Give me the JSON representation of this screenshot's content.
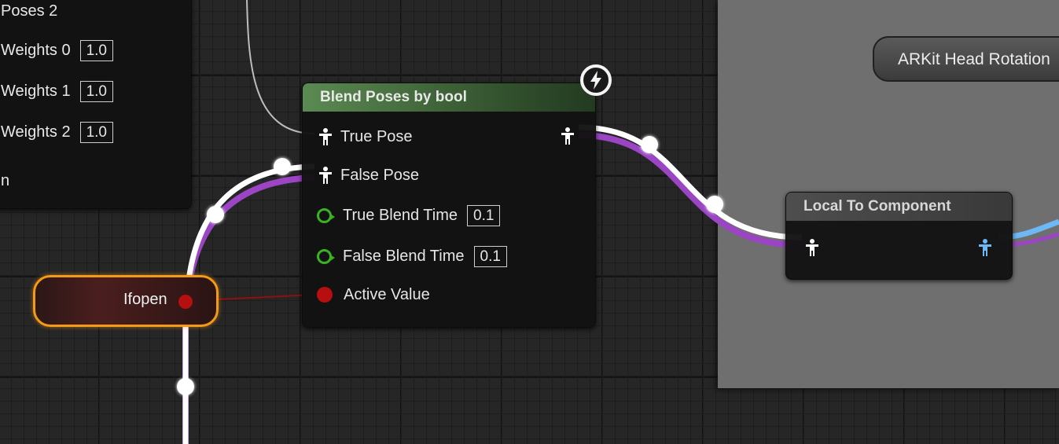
{
  "left_node": {
    "rows": [
      {
        "label": "Poses 2",
        "value": null
      },
      {
        "label": "Weights 0",
        "value": "1.0"
      },
      {
        "label": "Weights 1",
        "value": "1.0"
      },
      {
        "label": "Weights 2",
        "value": "1.0"
      },
      {
        "label": "n",
        "value": null
      }
    ]
  },
  "blend_node": {
    "title": "Blend Poses by bool",
    "header_color": "#4c6e46",
    "pins": {
      "true_pose": "True Pose",
      "false_pose": "False Pose",
      "true_blend_time": "True Blend Time",
      "true_blend_time_value": "0.1",
      "false_blend_time": "False Blend Time",
      "false_blend_time_value": "0.1",
      "active_value": "Active Value"
    },
    "icons": [
      "pose-icon",
      "exec-pin-icon",
      "bool-pin-icon",
      "lightning-icon"
    ]
  },
  "local_to_component": {
    "title": "Local To Component",
    "header_color": "#3a3a3a"
  },
  "variable_node": {
    "label": "Ifopen",
    "border_color": "#f59a16"
  },
  "arkit_node": {
    "label": "ARKit Head Rotation"
  },
  "colors": {
    "graph_bg": "#262626",
    "comment_bg": "#6f6f6f",
    "pose_wire": "#ffffff",
    "pose_wire_tint": "#9b45c4",
    "bool_wire": "#8e1010",
    "component_wire": "#6db8f5"
  }
}
